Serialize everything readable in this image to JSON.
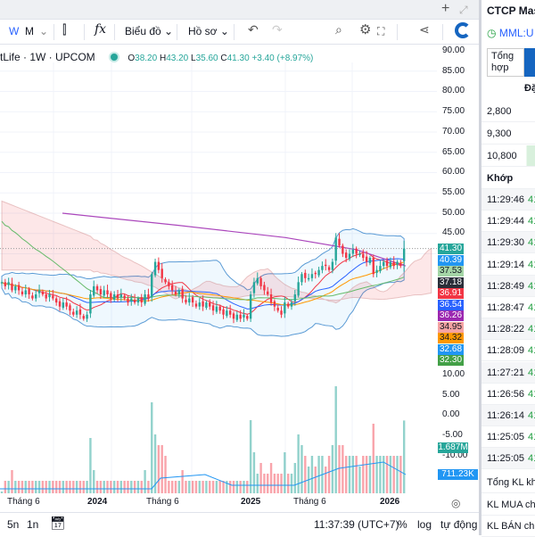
{
  "header": {
    "add_icon": "plus-icon",
    "expand_icon": "expand-icon"
  },
  "toolbar": {
    "interval_w": "W",
    "interval_m": "M",
    "chart_label": "Biểu đồ",
    "profile_label": "Hồ sơ"
  },
  "legend": {
    "symbol": "tLife · 1W · UPCOM",
    "o_label": "O",
    "o": "38.20",
    "h_label": "H",
    "h": "43.20",
    "l_label": "L",
    "l": "35.60",
    "c_label": "C",
    "c": "41.30",
    "change": "+3.40 (+8.97%)"
  },
  "price_axis": [
    "90.00",
    "85.00",
    "80.00",
    "75.00",
    "70.00",
    "65.00",
    "60.00",
    "55.00",
    "50.00",
    "45.00"
  ],
  "volume_axis": [
    "10.00",
    "5.00",
    "0.00",
    "-5.00",
    "-10.00"
  ],
  "badges": [
    {
      "v": "41.30",
      "c": "#26a69a"
    },
    {
      "v": "40.39",
      "c": "#2196f3"
    },
    {
      "v": "37.53",
      "c": "#a5d6a7",
      "t": "#131722"
    },
    {
      "v": "37.18",
      "c": "#2a2e39"
    },
    {
      "v": "36.91",
      "c": "#f23645"
    },
    {
      "v": "36.54",
      "c": "#2962ff"
    },
    {
      "v": "36.26",
      "c": "#9c27b0"
    },
    {
      "v": "34.95",
      "c": "#f5a3a3",
      "t": "#131722"
    },
    {
      "v": "34.32",
      "c": "#ff9800",
      "t": "#131722"
    },
    {
      "v": "32.68",
      "c": "#2196f3"
    },
    {
      "v": "32.30",
      "c": "#43a047"
    }
  ],
  "volume_badges": [
    {
      "v": "1.687M",
      "c": "#26a69a"
    },
    {
      "v": "711.23K",
      "c": "#2196f3"
    }
  ],
  "time_axis": [
    "Tháng 6",
    "2024",
    "Tháng 6",
    "2025",
    "Tháng 6",
    "2026"
  ],
  "bottom": {
    "r5": "5n",
    "r1": "1n",
    "clock": "11:37:39 (UTC+7)",
    "pct": "%",
    "log": "log",
    "auto": "tự động"
  },
  "panel": {
    "title": "CTCP Mas",
    "symbol": "MML:U",
    "tab": "Tổng hợp",
    "col": "Đặ",
    "orders": [
      "2,800",
      "9,300",
      "10,800"
    ],
    "match_header": "Khớp",
    "trades": [
      "11:29:46",
      "11:29:44",
      "11:29:30",
      "11:29:14",
      "11:28:49",
      "11:28:47",
      "11:28:22",
      "11:28:09",
      "11:27:21",
      "11:26:56",
      "11:26:14",
      "11:25:05",
      "11:25:05"
    ],
    "trade_price": "41",
    "totals": [
      "Tổng KL khớ",
      "KL MUA chủ",
      "KL BÁN chủ"
    ]
  },
  "chart_data": {
    "type": "candlestick",
    "closes": [
      33,
      32,
      33,
      31,
      32,
      31,
      30,
      31,
      30,
      29,
      30,
      31,
      30,
      29,
      30,
      29,
      28,
      27,
      28,
      27,
      26,
      25,
      26,
      25,
      24,
      25,
      30,
      32,
      31,
      30,
      31,
      30,
      29,
      30,
      29,
      30,
      29,
      28,
      29,
      28,
      29,
      28,
      30,
      29,
      35,
      38,
      36,
      34,
      33,
      32,
      31,
      30,
      31,
      29,
      28,
      29,
      28,
      27,
      28,
      27,
      28,
      27,
      26,
      27,
      26,
      25,
      26,
      25,
      24,
      25,
      24,
      25,
      24,
      30,
      33,
      34,
      32,
      31,
      30,
      28,
      27,
      26,
      25,
      28,
      27,
      28,
      30,
      33,
      35,
      34,
      34,
      35,
      35,
      36,
      37,
      37,
      36,
      38,
      44,
      42,
      40,
      39,
      40,
      41,
      40,
      40,
      39,
      38,
      39,
      35,
      36,
      37,
      38,
      37,
      38,
      37,
      38,
      37,
      41.3
    ],
    "last_ohlc": {
      "o": 38.2,
      "h": 43.2,
      "l": 35.6,
      "c": 41.3
    },
    "ylim_price": [
      22,
      90
    ],
    "colors": {
      "up": "#26a69a",
      "down": "#f23645"
    }
  }
}
